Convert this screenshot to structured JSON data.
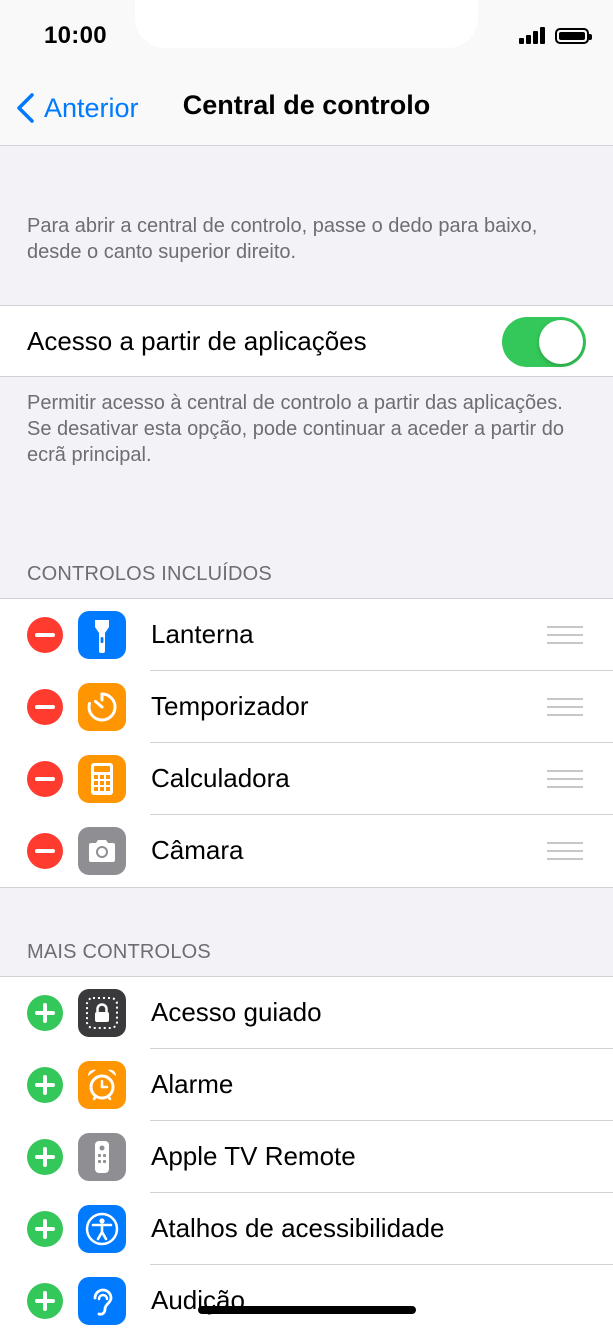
{
  "status_bar": {
    "time": "10:00"
  },
  "nav": {
    "back_label": "Anterior",
    "title": "Central de controlo"
  },
  "intro_text": "Para abrir a central de controlo, passe o dedo para baixo, desde o canto superior direito.",
  "app_access": {
    "label": "Acesso a partir de aplicações",
    "enabled": true,
    "footnote": "Permitir acesso à central de controlo a partir das aplicações. Se desativar esta opção, pode continuar a aceder a partir do ecrã principal."
  },
  "included": {
    "header": "CONTROLOS INCLUÍDOS",
    "items": [
      {
        "label": "Lanterna",
        "icon": "flashlight-icon",
        "color": "#007aff"
      },
      {
        "label": "Temporizador",
        "icon": "timer-icon",
        "color": "#ff9500"
      },
      {
        "label": "Calculadora",
        "icon": "calculator-icon",
        "color": "#ff9500"
      },
      {
        "label": "Câmara",
        "icon": "camera-icon",
        "color": "#8e8e93"
      }
    ]
  },
  "more": {
    "header": "MAIS CONTROLOS",
    "items": [
      {
        "label": "Acesso guiado",
        "icon": "guided-access-icon",
        "color": "#3a3a3c"
      },
      {
        "label": "Alarme",
        "icon": "alarm-icon",
        "color": "#ff9500"
      },
      {
        "label": "Apple TV Remote",
        "icon": "remote-icon",
        "color": "#8e8e93"
      },
      {
        "label": "Atalhos de acessibilidade",
        "icon": "accessibility-icon",
        "color": "#007aff"
      },
      {
        "label": "Audição",
        "icon": "hearing-icon",
        "color": "#007aff"
      }
    ]
  },
  "colors": {
    "accent": "#007aff",
    "toggle_on": "#34c759",
    "remove": "#ff3b30",
    "add": "#34c759"
  }
}
